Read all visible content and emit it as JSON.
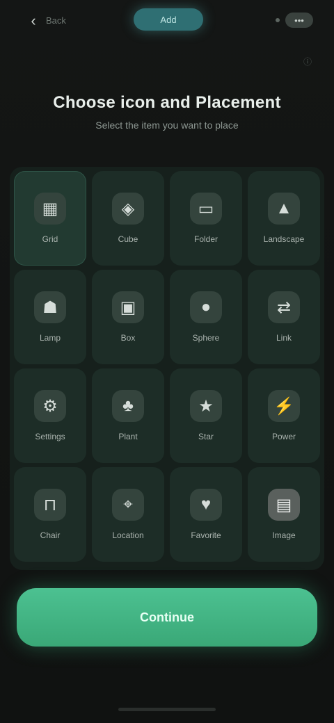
{
  "top_bar": {
    "back_icon": "chevron-left-icon",
    "back_label": "Back",
    "mode_label": "Add",
    "menu_icon": "more-icon",
    "menu_label": "•••"
  },
  "header": {
    "title": "Choose icon and Placement",
    "subtitle": "Select the item you want to place"
  },
  "tiles": [
    {
      "icon": "grid-icon",
      "glyph": "▦",
      "label": "Grid"
    },
    {
      "icon": "cube-icon",
      "glyph": "◈",
      "label": "Cube"
    },
    {
      "icon": "folder-icon",
      "glyph": "▭",
      "label": "Folder"
    },
    {
      "icon": "mountain-icon",
      "glyph": "▲",
      "label": "Landscape"
    },
    {
      "icon": "lamp-icon",
      "glyph": "☗",
      "label": "Lamp"
    },
    {
      "icon": "box-icon",
      "glyph": "▣",
      "label": "Box"
    },
    {
      "icon": "circle-icon",
      "glyph": "●",
      "label": "Sphere"
    },
    {
      "icon": "link-icon",
      "glyph": "⇄",
      "label": "Link"
    },
    {
      "icon": "gear-icon",
      "glyph": "⚙",
      "label": "Settings"
    },
    {
      "icon": "plant-icon",
      "glyph": "♣",
      "label": "Plant"
    },
    {
      "icon": "star-icon",
      "glyph": "★",
      "label": "Star"
    },
    {
      "icon": "bolt-icon",
      "glyph": "⚡",
      "label": "Power"
    },
    {
      "icon": "chair-icon",
      "glyph": "⊓",
      "label": "Chair"
    },
    {
      "icon": "location-icon",
      "glyph": "⌖",
      "label": "Location"
    },
    {
      "icon": "heart-icon",
      "glyph": "♥",
      "label": "Favorite"
    },
    {
      "icon": "image-icon",
      "glyph": "▤",
      "label": "Image"
    }
  ],
  "cta": {
    "label": "Continue"
  },
  "colors": {
    "accent": "#45b886",
    "pill": "#2f6f73",
    "background": "#111312"
  }
}
